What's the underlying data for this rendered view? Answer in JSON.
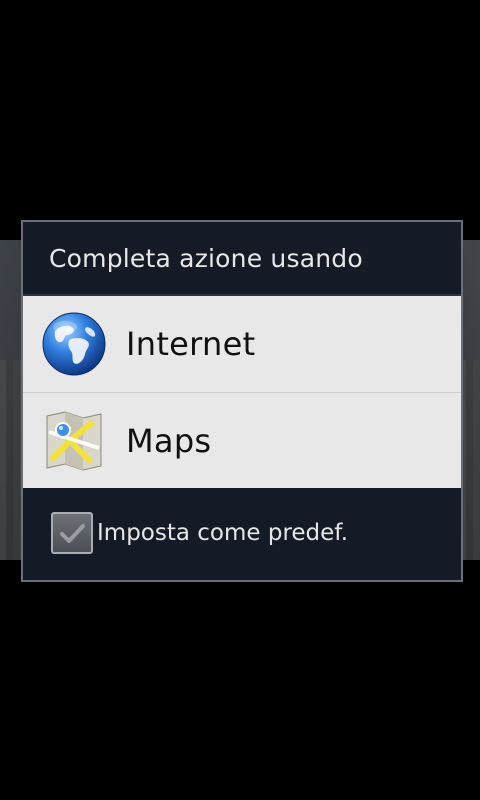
{
  "dialog": {
    "title": "Completa azione usando",
    "apps": [
      {
        "label": "Internet",
        "icon": "globe-icon"
      },
      {
        "label": "Maps",
        "icon": "maps-icon"
      }
    ],
    "default_checkbox": {
      "label": "Imposta come predef.",
      "checked": false
    }
  },
  "colors": {
    "dialog_dark": "#141b27",
    "list_background": "#e8e8e8",
    "title_text": "#e8e8e8",
    "item_text": "#111111"
  }
}
